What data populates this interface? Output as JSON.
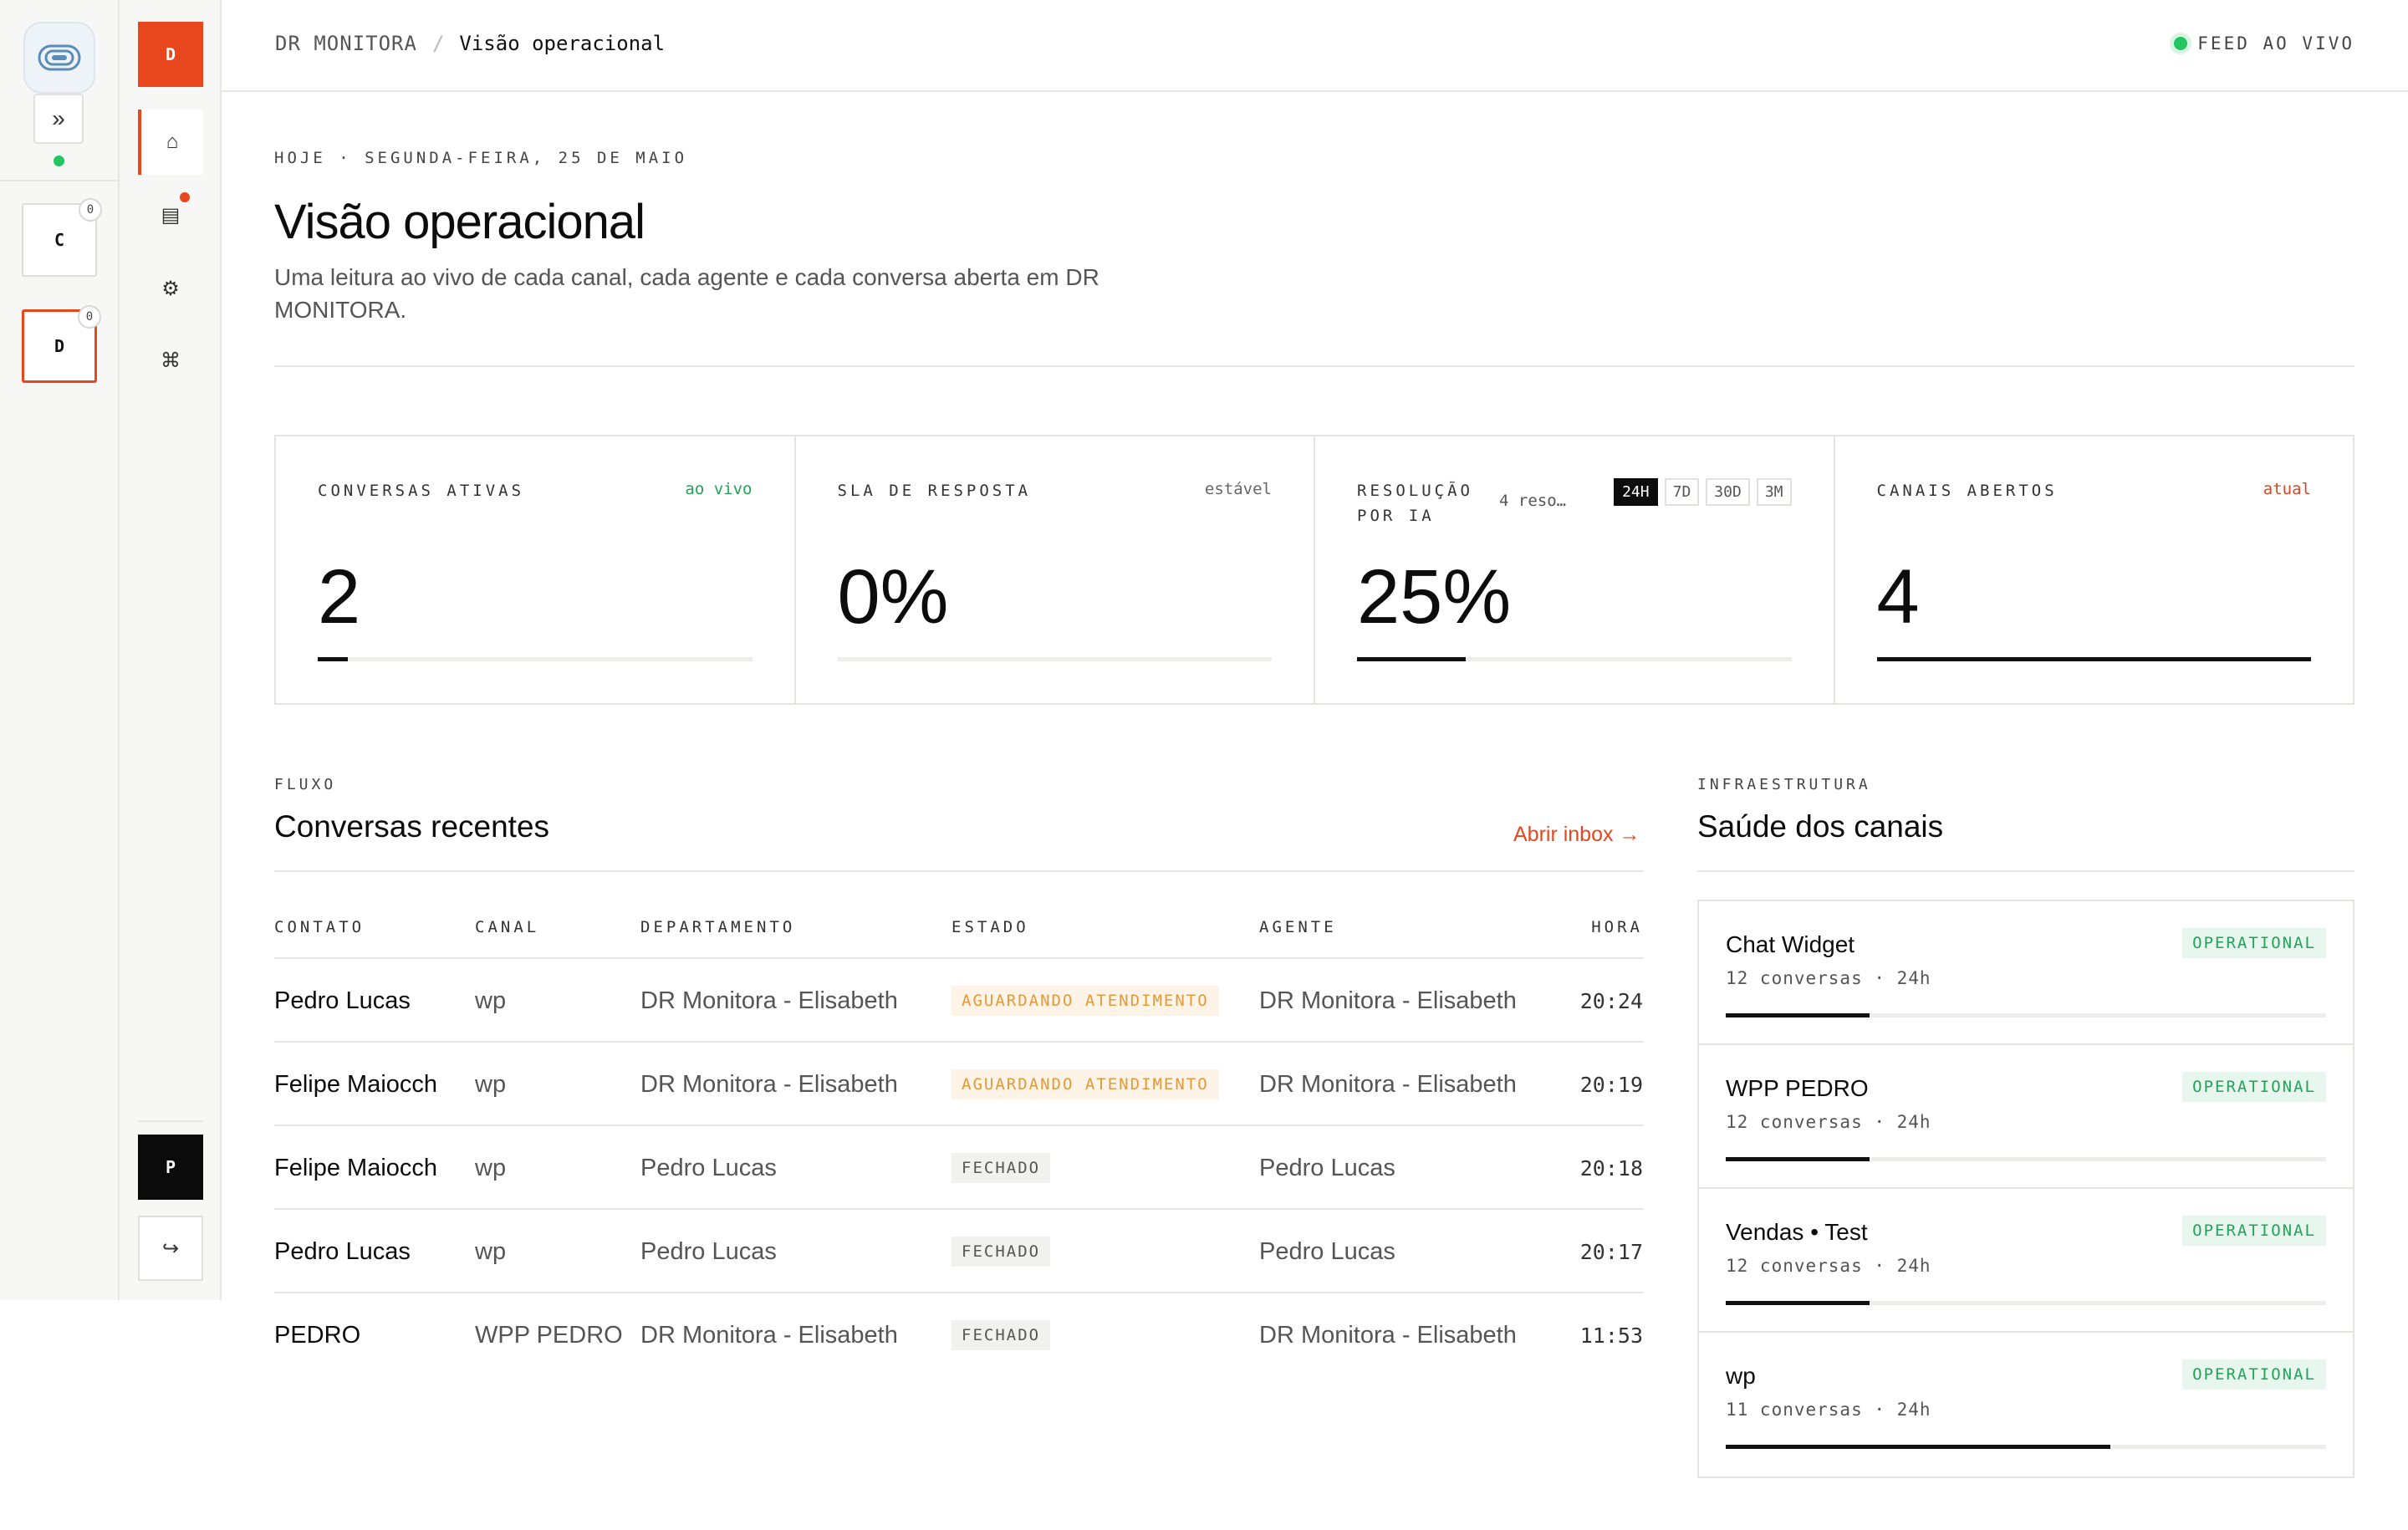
{
  "workspaces": [
    {
      "letter": "C",
      "badge": "0",
      "active": false
    },
    {
      "letter": "D",
      "badge": "0",
      "active": true
    }
  ],
  "rail": {
    "current_workspace": "D",
    "user_initial": "P"
  },
  "header": {
    "breadcrumb_root": "DR MONITORA",
    "breadcrumb_sep": "/",
    "breadcrumb_current": "Visão operacional",
    "live_feed": "FEED AO VIVO"
  },
  "page": {
    "date_line": "HOJE · SEGUNDA-FEIRA, 25 DE MAIO",
    "title": "Visão operacional",
    "subtitle": "Uma leitura ao vivo de cada canal, cada agente e cada conversa aberta em DR MONITORA."
  },
  "stats": [
    {
      "label": "CONVERSAS ATIVAS",
      "tag": "ao vivo",
      "tag_color": "#22a35a",
      "value": "2",
      "progress": 0.07
    },
    {
      "label": "SLA DE RESPOSTA",
      "tag": "estável",
      "tag_color": "#666666",
      "value": "0%",
      "progress": 0
    },
    {
      "label": "RESOLUÇÃO POR IA",
      "tag": "4 reso…",
      "value": "25%",
      "progress": 0.25,
      "ranges": [
        "24H",
        "7D",
        "30D",
        "3M"
      ],
      "active_range": "24H"
    },
    {
      "label": "CANAIS ABERTOS",
      "tag": "atual",
      "tag_color": "#d9461f",
      "value": "4",
      "progress": 1
    }
  ],
  "conversations": {
    "eyebrow": "FLUXO",
    "title": "Conversas recentes",
    "open_inbox": "Abrir inbox →",
    "columns": [
      "CONTATO",
      "CANAL",
      "DEPARTAMENTO",
      "ESTADO",
      "AGENTE",
      "HORA"
    ],
    "rows": [
      {
        "contact": "Pedro Lucas",
        "channel": "wp",
        "department": "DR Monitora - Elisabeth",
        "status": "AGUARDANDO ATENDIMENTO",
        "status_kind": "waiting",
        "agent": "DR Monitora - Elisabeth",
        "time": "20:24"
      },
      {
        "contact": "Felipe Maiocch",
        "channel": "wp",
        "department": "DR Monitora - Elisabeth",
        "status": "AGUARDANDO ATENDIMENTO",
        "status_kind": "waiting",
        "agent": "DR Monitora - Elisabeth",
        "time": "20:19"
      },
      {
        "contact": "Felipe Maiocch",
        "channel": "wp",
        "department": "Pedro Lucas",
        "status": "FECHADO",
        "status_kind": "closed",
        "agent": "Pedro Lucas",
        "time": "20:18"
      },
      {
        "contact": "Pedro Lucas",
        "channel": "wp",
        "department": "Pedro Lucas",
        "status": "FECHADO",
        "status_kind": "closed",
        "agent": "Pedro Lucas",
        "time": "20:17"
      },
      {
        "contact": "PEDRO",
        "channel": "WPP PEDRO",
        "department": "DR Monitora - Elisabeth",
        "status": "FECHADO",
        "status_kind": "closed",
        "agent": "DR Monitora - Elisabeth",
        "time": "11:53"
      }
    ]
  },
  "health": {
    "eyebrow": "INFRAESTRUTURA",
    "title": "Saúde dos canais",
    "channels": [
      {
        "name": "Chat Widget",
        "meta": "12 conversas · 24h",
        "status": "OPERATIONAL",
        "level": 0.24
      },
      {
        "name": "WPP PEDRO",
        "meta": "12 conversas · 24h",
        "status": "OPERATIONAL",
        "level": 0.24
      },
      {
        "name": "Vendas • Test",
        "meta": "12 conversas · 24h",
        "status": "OPERATIONAL",
        "level": 0.24
      },
      {
        "name": "wp",
        "meta": "11 conversas · 24h",
        "status": "OPERATIONAL",
        "level": 0.64
      }
    ]
  }
}
